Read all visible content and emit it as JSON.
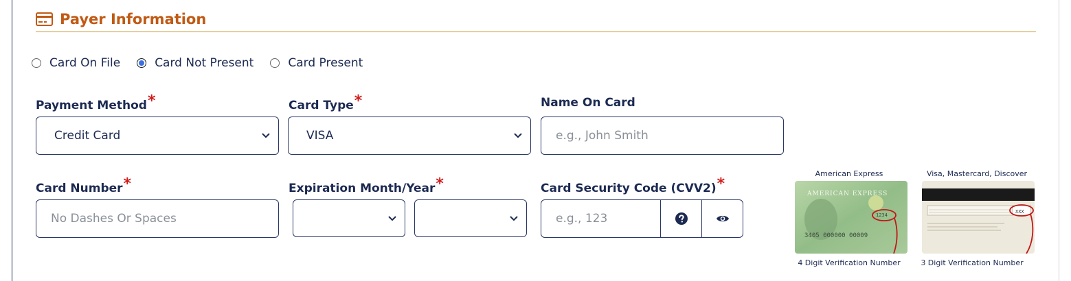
{
  "header": {
    "title": "Payer Information",
    "icon": "credit-card-icon",
    "color": "#c05a14"
  },
  "payment_source": {
    "options": [
      {
        "label": "Card On File",
        "checked": false
      },
      {
        "label": "Card Not Present",
        "checked": true
      },
      {
        "label": "Card Present",
        "checked": false
      }
    ]
  },
  "fields": {
    "payment_method": {
      "label": "Payment Method",
      "required_mark": "*",
      "value": "Credit Card"
    },
    "card_type": {
      "label": "Card Type",
      "required_mark": "*",
      "value": "VISA"
    },
    "name_on_card": {
      "label": "Name On Card",
      "placeholder": "e.g., John Smith"
    },
    "card_number": {
      "label": "Card Number",
      "required_mark": "*",
      "placeholder": "No Dashes Or Spaces"
    },
    "expiration": {
      "label": "Expiration Month/Year",
      "required_mark": "*",
      "month_value": "",
      "year_value": ""
    },
    "cvv": {
      "label": "Card Security Code (CVV2)",
      "required_mark": "*",
      "placeholder": "e.g., 123",
      "help_icon": "question-circle-icon",
      "reveal_icon": "eye-icon"
    }
  },
  "card_images": {
    "amex": {
      "top_caption": "American Express",
      "bottom_caption": "4 Digit Verification Number",
      "card_brand_text": "AMERICAN EXPRESS",
      "sample_code": "1234",
      "sample_number": "3405 000000 00009"
    },
    "visa_mc_discover": {
      "top_caption": "Visa, Mastercard, Discover",
      "bottom_caption": "3 Digit Verification Number",
      "sample_code": "XXX"
    }
  }
}
